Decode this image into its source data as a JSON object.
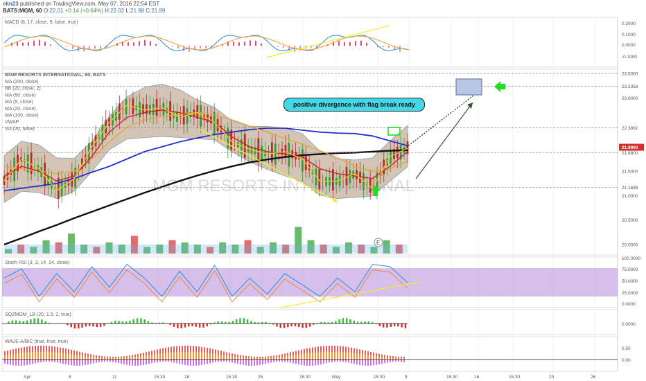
{
  "header": {
    "user": "ekn23",
    "published": "published on TradingView.com, May 07, 2016 22:54 EST",
    "symbol": "BATS:MGM, 60",
    "o_label": "O:",
    "o": "22.01",
    "change": "+0.14 (+0.64%)",
    "h_label": "H:",
    "h": "22.02",
    "l_label": "L:",
    "l": "21.98",
    "c_label": "C:",
    "c": "21.99"
  },
  "main_pane": {
    "title": "MGM RESORTS INTERNATIONAL, 60, BATS",
    "indicators": [
      "MA (200, close)",
      "BB (20, close, 2)",
      "MA (50, close)",
      "MA (9, close)",
      "MA (20, close)",
      "MA (100, close)",
      "VWAP",
      "Vol (20, false)"
    ],
    "watermark": "MGM RESORTS INTERNATIONAL",
    "callout": "positive divergence with flag break ready",
    "price_ticks": [
      "23.5000",
      "23.2358",
      "23.0000",
      "22.3892",
      "21.9900",
      "21.8800",
      "21.5000",
      "21.1698",
      "21.0000",
      "20.5000",
      "20.0000"
    ],
    "last_price": "21.9900",
    "event_marker": "E"
  },
  "macd_pane": {
    "title": "MACD (8, 17, close, 9, false, true)",
    "ticks": [
      "0.2000",
      "0.1000",
      "0.0000",
      "-0.1000"
    ]
  },
  "stoch_pane": {
    "title": "Stoch RSI (3, 3, 14, 14, close)",
    "ticks": [
      "100.0000",
      "75.0000",
      "50.0000",
      "25.0000",
      "0.0000"
    ]
  },
  "sqz_pane": {
    "title": "SQZMOM_LB (20, 1.5, 2, true)",
    "ticks": [
      "0.0000"
    ]
  },
  "wave_pane": {
    "title": "WAVE-A/B/C (true, true, true)",
    "ticks": [
      "0.50",
      "0.00"
    ]
  },
  "x_axis": [
    "Apr",
    "8",
    "11",
    "15:30",
    "18",
    "15:30",
    "25",
    "15:30",
    "May",
    "15:30",
    "9",
    "15:30",
    "16",
    "15:30",
    "23",
    "26"
  ],
  "colors": {
    "ma200": "#111111",
    "ma100": "#2430cc",
    "ma50": "#e8a23c",
    "ma20": "#cc2222",
    "ma9": "#f2d21e",
    "bb_fill": "#a07c5a",
    "up": "#4caf50",
    "down": "#e05050",
    "stoch_band": "#b58ad8",
    "annotation_yellow": "#f2ee30",
    "annotation_green": "#22dd22",
    "callout": "#44d8e6"
  },
  "chart_data": [
    {
      "type": "line",
      "title": "MGM RESORTS INTERNATIONAL, 60, BATS",
      "ylim": [
        19.9,
        23.6
      ],
      "series": [
        {
          "name": "MA (200, close)",
          "values": [
            20.0,
            20.13,
            20.27,
            20.4,
            20.54,
            20.67,
            20.8,
            20.93,
            21.06,
            21.18,
            21.3,
            21.41,
            21.51,
            21.6,
            21.68,
            21.74,
            21.79,
            21.83,
            21.85,
            21.87,
            21.88,
            21.9,
            21.92,
            21.93
          ]
        },
        {
          "name": "MA (100, close)",
          "values": [
            21.1,
            21.15,
            21.2,
            21.25,
            21.35,
            21.48,
            21.6,
            21.75,
            21.9,
            22.0,
            22.1,
            22.18,
            22.25,
            22.3,
            22.35,
            22.38,
            22.38,
            22.34,
            22.3,
            22.28,
            22.27,
            22.22,
            22.12,
            22.02
          ]
        },
        {
          "name": "MA (50, close)",
          "values": [
            21.6,
            21.55,
            21.5,
            21.45,
            21.5,
            21.75,
            22.1,
            22.4,
            22.55,
            22.62,
            22.66,
            22.7,
            22.65,
            22.55,
            22.42,
            22.3,
            22.17,
            22.05,
            21.92,
            21.78,
            21.6,
            21.5,
            21.55,
            21.7
          ]
        },
        {
          "name": "MA (20, close)",
          "values": [
            21.4,
            21.6,
            21.5,
            21.3,
            21.4,
            21.8,
            22.3,
            22.6,
            22.7,
            22.75,
            22.7,
            22.6,
            22.5,
            22.2,
            22.0,
            21.9,
            21.85,
            21.8,
            21.55,
            21.45,
            21.4,
            21.35,
            21.6,
            21.9
          ]
        },
        {
          "name": "MA (9, close)",
          "values": [
            21.3,
            21.75,
            21.55,
            21.1,
            21.35,
            22.0,
            22.5,
            22.85,
            22.75,
            22.8,
            22.6,
            22.7,
            22.5,
            22.1,
            21.95,
            21.85,
            21.9,
            21.75,
            21.3,
            21.3,
            21.45,
            21.15,
            21.8,
            21.97
          ]
        }
      ]
    },
    {
      "type": "bar",
      "title": "Vol (20, false)",
      "values": [
        2,
        4,
        3,
        6,
        5,
        9,
        4,
        3,
        5,
        4,
        8,
        3,
        4,
        6,
        5,
        4,
        3,
        5,
        4,
        6,
        3,
        5,
        4,
        12,
        6,
        4,
        3,
        5,
        4,
        3,
        6,
        4
      ]
    },
    {
      "type": "line",
      "title": "Stoch RSI (3, 3, 14, 14, close)",
      "ylim": [
        0,
        100
      ],
      "series": [
        {
          "name": "K",
          "values": [
            60,
            80,
            20,
            70,
            30,
            85,
            40,
            90,
            60,
            20,
            75,
            30,
            88,
            20,
            60,
            25,
            70,
            45,
            20,
            60,
            30,
            90,
            85,
            50
          ]
        }
      ]
    }
  ]
}
